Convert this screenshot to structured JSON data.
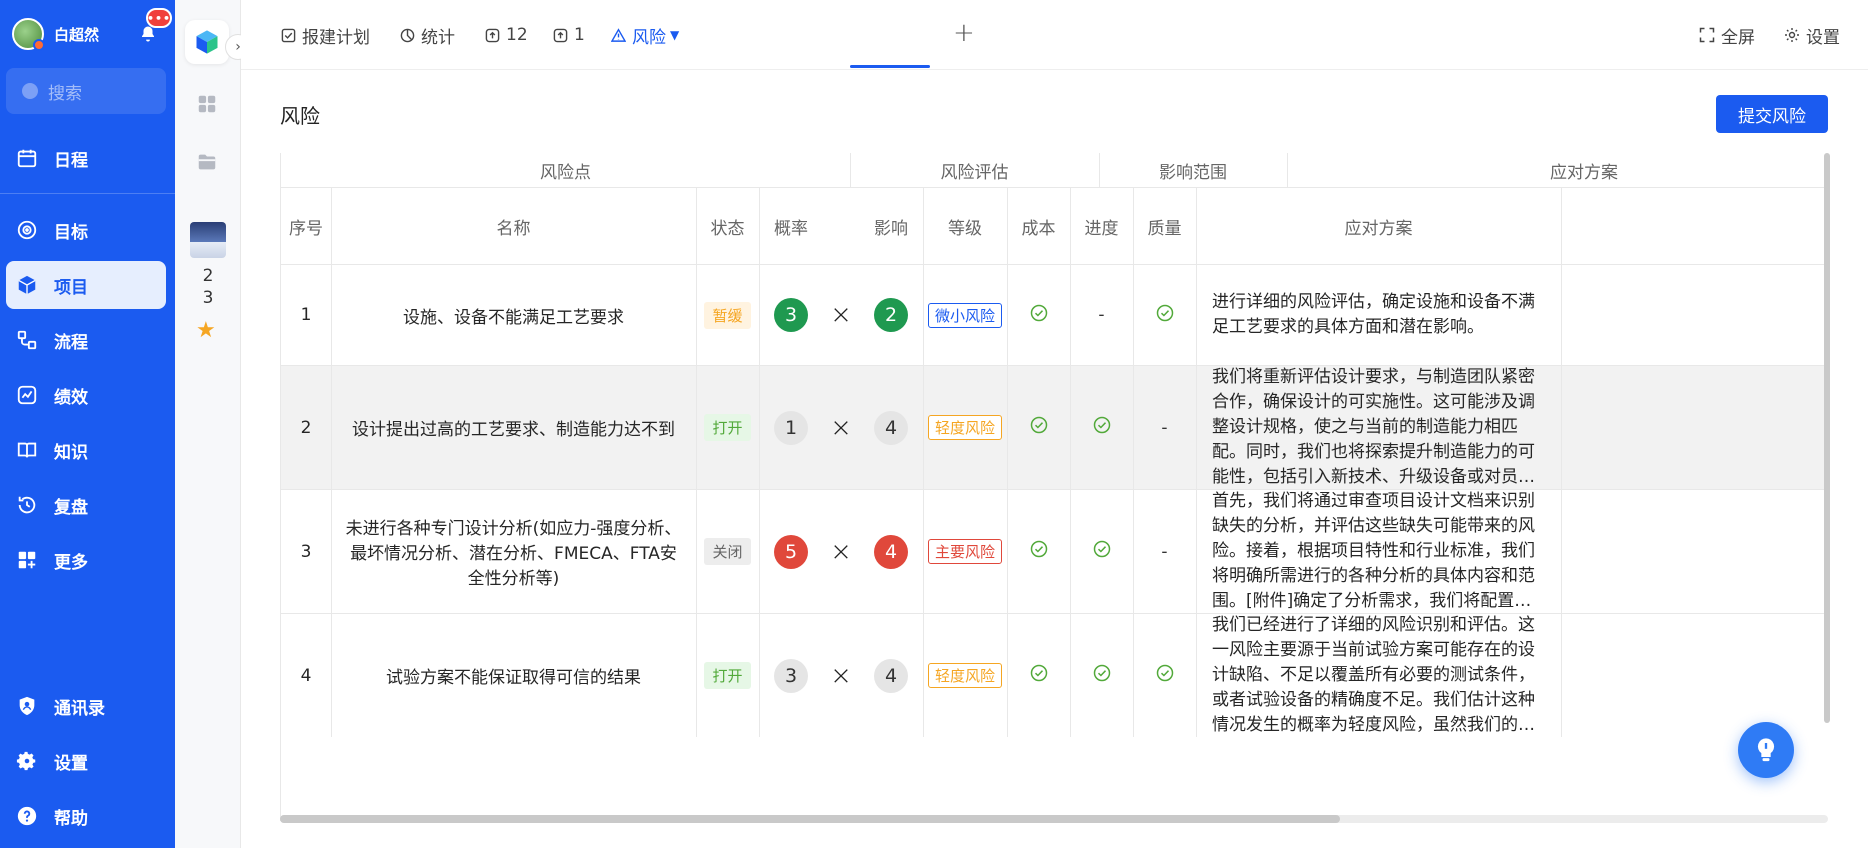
{
  "user": {
    "name": "白超然",
    "notification_badge": "•••"
  },
  "search": {
    "placeholder": "搜索"
  },
  "sidebar": {
    "items": [
      {
        "key": "schedule",
        "label": "日程",
        "icon": "calendar-icon"
      },
      {
        "key": "goal",
        "label": "目标",
        "icon": "target-icon"
      },
      {
        "key": "project",
        "label": "项目",
        "icon": "cube-icon",
        "active": true
      },
      {
        "key": "flow",
        "label": "流程",
        "icon": "flow-icon"
      },
      {
        "key": "performance",
        "label": "绩效",
        "icon": "chart-icon"
      },
      {
        "key": "knowledge",
        "label": "知识",
        "icon": "book-icon"
      },
      {
        "key": "review",
        "label": "复盘",
        "icon": "review-icon"
      },
      {
        "key": "more",
        "label": "更多",
        "icon": "grid-plus-icon"
      }
    ],
    "bottom": [
      {
        "key": "contacts",
        "label": "通讯录",
        "icon": "contacts-icon"
      },
      {
        "key": "settings",
        "label": "设置",
        "icon": "gear-icon"
      },
      {
        "key": "help",
        "label": "帮助",
        "icon": "help-icon"
      }
    ]
  },
  "col2": {
    "thumb_nums": [
      "2",
      "3"
    ]
  },
  "tabs": [
    {
      "key": "plan",
      "label": "报建计划",
      "icon": "checkbox-icon"
    },
    {
      "key": "stats",
      "label": "统计",
      "icon": "pie-icon"
    },
    {
      "key": "t12",
      "label": "12",
      "icon": "upload-icon"
    },
    {
      "key": "t1",
      "label": "1",
      "icon": "upload-icon"
    },
    {
      "key": "risk",
      "label": "风险",
      "icon": "warning-icon",
      "active": true
    }
  ],
  "topright": {
    "fullscreen": "全屏",
    "settings": "设置"
  },
  "page": {
    "title": "风险",
    "submit_label": "提交风险"
  },
  "table": {
    "groups": [
      "风险点",
      "风险评估",
      "影响范围",
      "应对方案"
    ],
    "columns": {
      "index": "序号",
      "name": "名称",
      "status": "状态",
      "probability": "概率",
      "impact": "影响",
      "level": "等级",
      "cost": "成本",
      "progress": "进度",
      "quality": "质量",
      "plan": "应对方案"
    },
    "rows": [
      {
        "index": "1",
        "name": "设施、设备不能满足工艺要求",
        "status": "暂缓",
        "status_type": "pause",
        "probability": "3",
        "prob_color": "green",
        "impact": "2",
        "impact_color": "green",
        "times": "×",
        "level": "微小风险",
        "level_type": "minor",
        "cost": "check",
        "progress": "-",
        "quality": "check",
        "plan": "进行详细的风险评估，确定设施和设备不满足工艺要求的具体方面和潜在影响。"
      },
      {
        "index": "2",
        "name": "设计提出过高的工艺要求、制造能力达不到",
        "status": "打开",
        "status_type": "open",
        "probability": "1",
        "prob_color": "gray",
        "impact": "4",
        "impact_color": "gray",
        "times": "×",
        "level": "轻度风险",
        "level_type": "light",
        "cost": "check",
        "progress": "check",
        "quality": "-",
        "plan": "我们将重新评估设计要求，与制造团队紧密合作，确保设计的可实施性。这可能涉及调整设计规格，使之与当前的制造能力相匹配。同时，我们也将探索提升制造能力的可能性，包括引入新技术、升级设备或对员工进行额外培训。此外，我们会考虑与外部供应商合作。"
      },
      {
        "index": "3",
        "name": "未进行各种专门设计分析(如应力-强度分析、 最坏情况分析、潜在分析、FMECA、FTA安全性分析等)",
        "status": "关闭",
        "status_type": "closed",
        "probability": "5",
        "prob_color": "red",
        "impact": "4",
        "impact_color": "red",
        "times": "×",
        "level": "主要风险",
        "level_type": "major",
        "cost": "check",
        "progress": "check",
        "quality": "-",
        "plan": "首先，我们将通过审查项目设计文档来识别缺失的分析，并评估这些缺失可能带来的风险。接着，根据项目特性和行业标准，我们将明确所需进行的各种分析的具体内容和范围。[附件]确定了分析需求，我们将配置必要的资源和专家团队来执行这些分析。这包括制定时间表。"
      },
      {
        "index": "4",
        "name": "试验方案不能保证取得可信的结果",
        "status": "打开",
        "status_type": "open",
        "probability": "3",
        "prob_color": "gray",
        "impact": "4",
        "impact_color": "gray",
        "times": "×",
        "level": "轻度风险",
        "level_type": "light",
        "cost": "check",
        "progress": "check",
        "quality": "check",
        "plan": "我们已经进行了详细的风险识别和评估。这一风险主要源于当前试验方案可能存在的设计缺陷、不足以覆盖所有必要的测试条件，或者试验设备的精确度不足。我们估计这种情况发生的概率为轻度风险，虽然我们的团队具有相应的专业知识，但试验方案仍需完善。"
      }
    ]
  },
  "colors": {
    "brand": "#1b5bf0",
    "risk_green": "#1f9950",
    "risk_red": "#e0483b",
    "warn": "#f5a623",
    "ok": "#52a93a"
  }
}
